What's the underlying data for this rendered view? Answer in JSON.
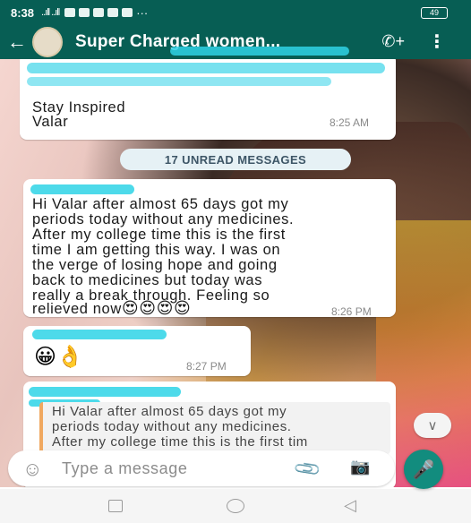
{
  "status_bar": {
    "time": "8:38",
    "signal": "..ıll ..ıll",
    "more": "···",
    "battery": "49"
  },
  "header": {
    "back_icon": "arrow-left-icon",
    "chat_title": "Super Charged women...",
    "call_icon": "add-call-icon",
    "menu_icon": "more-vert-icon"
  },
  "messages": {
    "top": {
      "line_stay": "Stay Inspired",
      "line_name": "Valar",
      "time": "8:25 AM"
    },
    "unread_label": "17 UNREAD MESSAGES",
    "long": {
      "lines": [
        "Hi Valar after almost 65 days got my",
        "periods today without any medicines.",
        "After my college time this is the first",
        "time I am getting this way. I was on",
        "the verge of losing hope and going",
        "back to medicines but today was",
        "really a break through. Feeling so",
        "relieved now"
      ],
      "emojis": "😍😍😍😍",
      "time": "8:26 PM"
    },
    "emoji_msg": {
      "emojis": "😀👌",
      "time": "8:27 PM"
    },
    "reply": {
      "quoted_lines": [
        "Hi Valar after almost 65 days got my",
        "periods today without any medicines.",
        "After my college time this is the first tim"
      ]
    }
  },
  "input": {
    "placeholder": "Type a message",
    "emoji_icon": "smiley-icon",
    "attach_icon": "paperclip-icon",
    "camera_icon": "camera-icon",
    "mic_icon": "mic-icon"
  },
  "colors": {
    "primary": "#075e54",
    "accent": "#128c7e"
  }
}
